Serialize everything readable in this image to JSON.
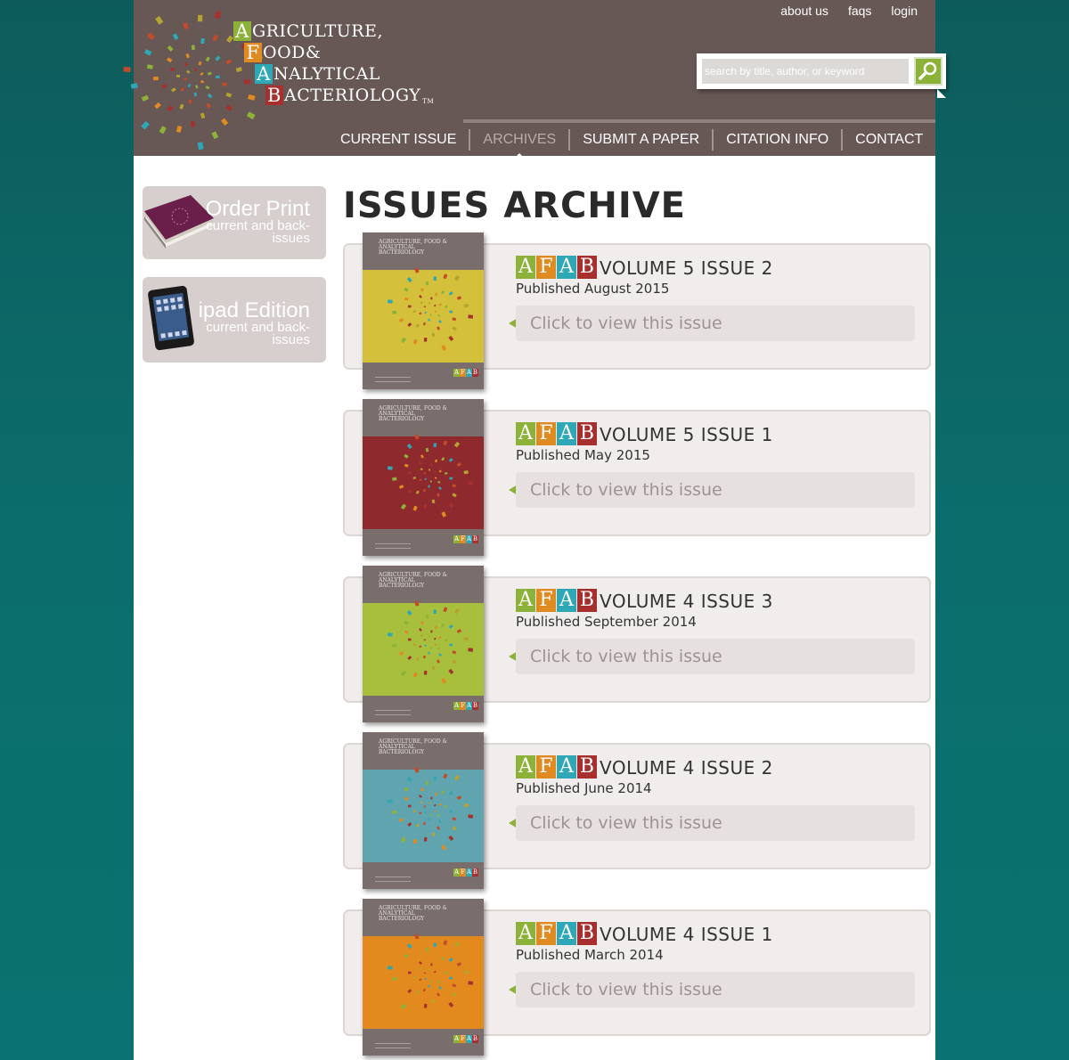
{
  "colors": {
    "page_bg": "#0b6a69",
    "header_bg": "#675755",
    "accent_green": "#8cb23a",
    "afab_a1": "#8cb23a",
    "afab_f": "#e08b22",
    "afab_a2": "#2ea7b7",
    "afab_b": "#a7302f"
  },
  "logo": {
    "line1_cap": "A",
    "line1_rest": "GRICULTURE,",
    "line2_cap": "F",
    "line2_rest": "OOD&",
    "line3_cap": "A",
    "line3_rest": "NALYTICAL",
    "line4_cap": "B",
    "line4_rest": "ACTERIOLOGY",
    "tm": "TM"
  },
  "toplinks": {
    "about": "about us",
    "faqs": "faqs",
    "login": "login"
  },
  "search": {
    "placeholder": "search by title, author, or keyword",
    "button_icon": "search-icon"
  },
  "nav": {
    "current_issue": "CURRENT ISSUE",
    "archives": "ARCHIVES",
    "submit": "SUBMIT A PAPER",
    "citation": "CITATION INFO",
    "contact": "CONTACT"
  },
  "sidebar": {
    "order": {
      "title": "Order Print",
      "sub": "current and back-issues",
      "icon": "print-magazine-icon"
    },
    "ipad": {
      "title": "ipad Edition",
      "sub": "current and back-issues",
      "icon": "ipad-icon"
    }
  },
  "main": {
    "title": "ISSUES ARCHIVE",
    "afab_letters": [
      "A",
      "F",
      "A",
      "B"
    ],
    "view_label": "Click to view this issue",
    "cover_title": "AGRICULTURE, FOOD & ANALYTICAL BACTERIOLOGY",
    "issues": [
      {
        "volume": "VOLUME 5 ISSUE 2",
        "published": "Published August 2015",
        "cover_color": "#d4c03a"
      },
      {
        "volume": "VOLUME 5 ISSUE 1",
        "published": "Published May 2015",
        "cover_color": "#8e2a2d"
      },
      {
        "volume": "VOLUME 4 ISSUE 3",
        "published": "Published September 2014",
        "cover_color": "#a7bf3c"
      },
      {
        "volume": "VOLUME 4 ISSUE 2",
        "published": "Published June 2014",
        "cover_color": "#5fa4ae"
      },
      {
        "volume": "VOLUME 4 ISSUE 1",
        "published": "Published March 2014",
        "cover_color": "#e28a1e"
      }
    ]
  }
}
